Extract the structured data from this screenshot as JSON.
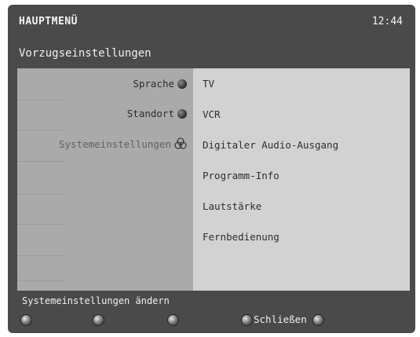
{
  "header": {
    "title": "HAUPTMENÜ",
    "clock": "12:44"
  },
  "section": {
    "title": "Vorzugseinstellungen"
  },
  "menu": {
    "items": [
      {
        "label": "Sprache",
        "icon": "disc-icon",
        "selected": false
      },
      {
        "label": "Standort",
        "icon": "disc-icon",
        "selected": false
      },
      {
        "label": "Systemeinstellungen",
        "icon": "rings-icon",
        "selected": true
      }
    ]
  },
  "options": {
    "items": [
      {
        "label": "TV"
      },
      {
        "label": "VCR"
      },
      {
        "label": "Digitaler Audio-Ausgang"
      },
      {
        "label": "Programm-Info"
      },
      {
        "label": "Lautstärke"
      },
      {
        "label": "Fernbedienung"
      }
    ]
  },
  "footer": {
    "hint": "Systemeinstellungen ändern",
    "buttons": [
      {
        "icon": "color-key-1-icon",
        "label": ""
      },
      {
        "icon": "color-key-2-icon",
        "label": ""
      },
      {
        "icon": "color-key-3-icon",
        "label": ""
      },
      {
        "icon": "color-key-4-icon",
        "label": "Schließen"
      },
      {
        "icon": "color-key-5-icon",
        "label": ""
      }
    ]
  },
  "colors": {
    "frame": "#4a4a4a",
    "left_panel": "#aaaaaa",
    "right_panel": "#d2d2d2",
    "text_light": "#f0f0f0",
    "text_dark": "#2c2c2c"
  }
}
